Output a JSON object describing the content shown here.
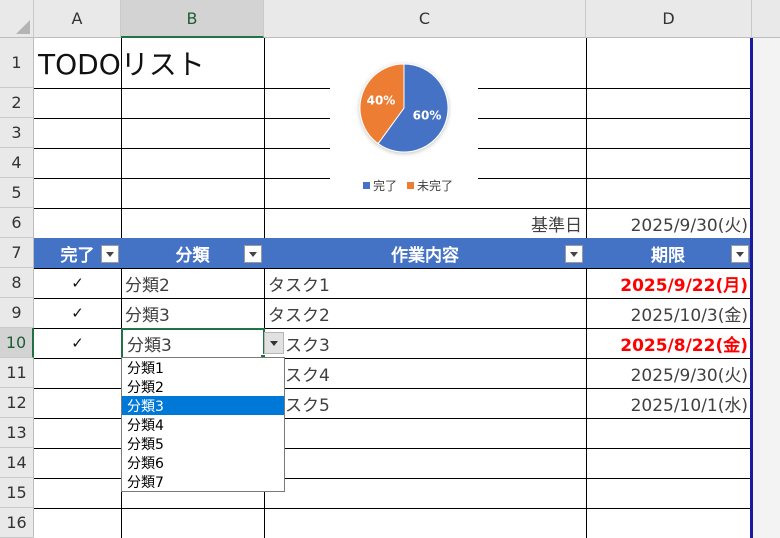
{
  "columns": [
    "A",
    "B",
    "C",
    "D"
  ],
  "rows": [
    "1",
    "2",
    "3",
    "4",
    "5",
    "6",
    "7",
    "8",
    "9",
    "10",
    "11",
    "12",
    "13",
    "14",
    "15",
    "16"
  ],
  "title": "TODOリスト",
  "base_date_label": "基準日",
  "base_date_value": "2025/9/30(火)",
  "headers": {
    "done": "完了",
    "category": "分類",
    "task": "作業内容",
    "deadline": "期限"
  },
  "table_rows": [
    {
      "done": "✓",
      "category": "分類2",
      "task": "タスク1",
      "deadline": "2025/9/22(月)",
      "overdue": true
    },
    {
      "done": "✓",
      "category": "分類3",
      "task": "タスク2",
      "deadline": "2025/10/3(金)",
      "overdue": false
    },
    {
      "done": "✓",
      "category": "分類3",
      "task": "タスク3",
      "deadline": "2025/8/22(金)",
      "overdue": true
    },
    {
      "done": "",
      "category": "",
      "task": "タスク4",
      "deadline": "2025/9/30(火)",
      "overdue": false
    },
    {
      "done": "",
      "category": "",
      "task": "タスク5",
      "deadline": "2025/10/1(水)",
      "overdue": false
    }
  ],
  "dropdown_options": [
    "分類1",
    "分類2",
    "分類3",
    "分類4",
    "分類5",
    "分類6",
    "分類7"
  ],
  "dropdown_selected": "分類3",
  "chart_data": {
    "type": "pie",
    "categories": [
      "完了",
      "未完了"
    ],
    "values": [
      60,
      40
    ],
    "data_labels": [
      "60%",
      "40%"
    ],
    "colors": [
      "#4472c4",
      "#ed7d31"
    ],
    "legend": "bottom"
  },
  "colors": {
    "header_blue": "#4472c4",
    "overdue_red": "#ff0000",
    "selection_green": "#217346"
  }
}
